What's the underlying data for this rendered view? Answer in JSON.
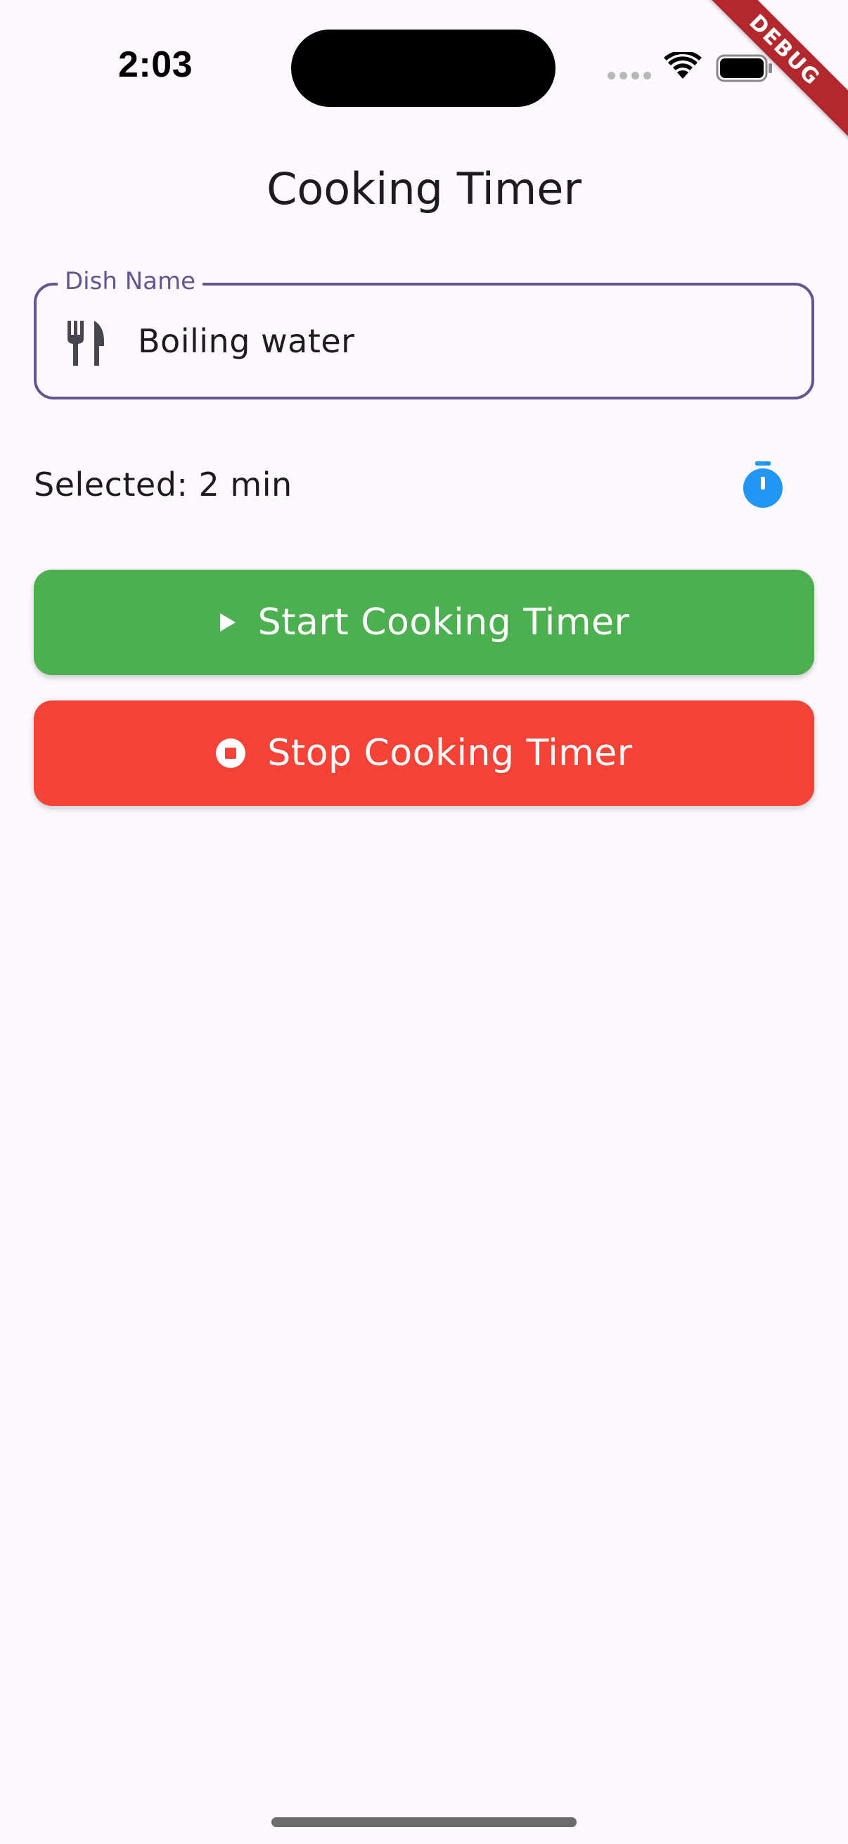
{
  "status_bar": {
    "time": "2:03",
    "icons": [
      "signal-dots-icon",
      "wifi-icon",
      "battery-icon"
    ]
  },
  "debug_banner": "DEBUG",
  "app_bar": {
    "title": "Cooking Timer"
  },
  "dish_field": {
    "label": "Dish Name",
    "value": "Boiling water",
    "icon": "restaurant-icon",
    "border_color": "#65558F"
  },
  "timer_selection": {
    "text": "Selected: 2 min",
    "icon": "timer-icon",
    "icon_color": "#2196F3"
  },
  "buttons": {
    "start": {
      "label": "Start Cooking Timer",
      "icon": "play-icon",
      "color": "#4CAF50"
    },
    "stop": {
      "label": "Stop Cooking Timer",
      "icon": "stop-circle-icon",
      "color": "#F44336"
    }
  },
  "colors": {
    "background": "#FDF7FE",
    "text": "#1D1B20"
  }
}
